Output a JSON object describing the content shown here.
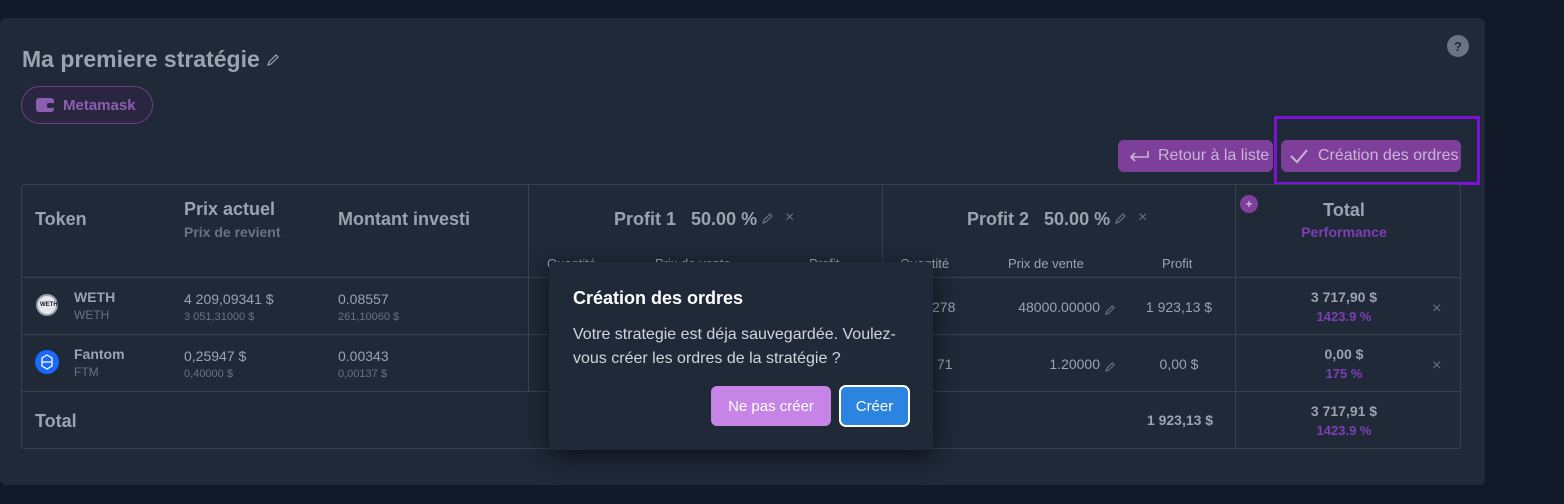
{
  "strategy": {
    "title": "Ma premiere stratégie",
    "wallet": "Metamask"
  },
  "help": {
    "label": "?"
  },
  "actions": {
    "back": "Retour à la liste",
    "create_orders": "Création des ordres"
  },
  "table": {
    "headers": {
      "token": "Token",
      "price": "Prix actuel",
      "cost": "Prix de revient",
      "invested": "Montant investi",
      "profit1_label": "Profit 1",
      "profit1_pct": "50.00 %",
      "profit2_label": "Profit 2",
      "profit2_pct": "50.00 %",
      "total": "Total",
      "performance": "Performance",
      "p1_qty": "Quantité",
      "p1_price": "Prix de vente",
      "p1_profit": "Profit",
      "p2_qty": "Quantité",
      "p2_price": "Prix de vente",
      "p2_profit": "Profit"
    },
    "rows": [
      {
        "name": "WETH",
        "symbol": "WETH",
        "price": "4 209,09341 $",
        "cost": "3 051,31000 $",
        "invested": "0.08557",
        "invested_sub": "261,10060 $",
        "p2_qty": "278",
        "p2_price": "48000.00000",
        "p2_profit": "1 923,13 $",
        "total": "3 717,90 $",
        "perf": "1423.9 %"
      },
      {
        "name": "Fantom",
        "symbol": "FTM",
        "price": "0,25947 $",
        "cost": "0,40000 $",
        "invested": "0.00343",
        "invested_sub": "0,00137 $",
        "p2_qty": "71",
        "p2_price": "1.20000",
        "p2_profit": "0,00 $",
        "total": "0,00 $",
        "perf": "175 %"
      }
    ],
    "footer": {
      "label": "Total",
      "p2_profit": "1 923,13 $",
      "total": "3 717,91 $",
      "perf": "1423.9 %"
    }
  },
  "modal": {
    "title": "Création des ordres",
    "text": "Votre strategie est déja sauvegardée. Voulez-vous créer les ordres de la stratégie ?",
    "cancel": "Ne pas créer",
    "confirm": "Créer"
  }
}
